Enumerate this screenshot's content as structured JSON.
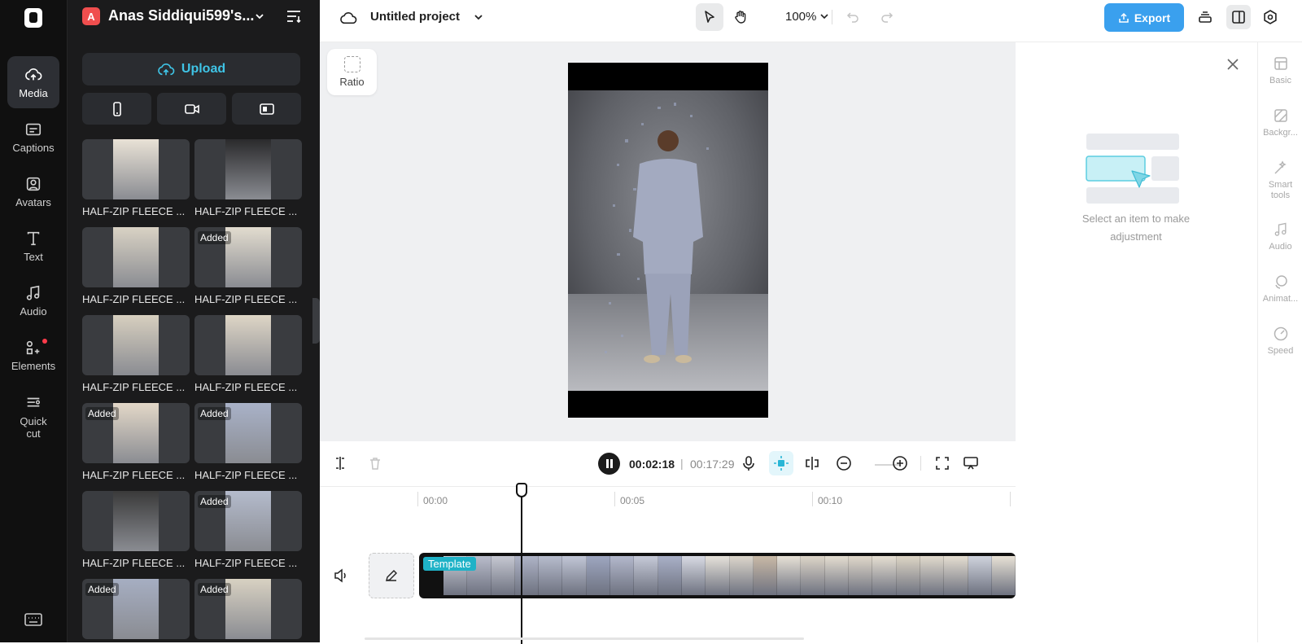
{
  "rail": {
    "items": [
      {
        "label": "Media",
        "icon": "cloud-upload-icon"
      },
      {
        "label": "Captions",
        "icon": "captions-icon"
      },
      {
        "label": "Avatars",
        "icon": "avatar-icon"
      },
      {
        "label": "Text",
        "icon": "text-icon"
      },
      {
        "label": "Audio",
        "icon": "music-note-icon"
      },
      {
        "label": "Elements",
        "icon": "elements-icon"
      },
      {
        "label": "Quick cut",
        "icon": "quick-cut-icon"
      }
    ]
  },
  "panel": {
    "workspace_initial": "A",
    "workspace_name": "Anas Siddiqui599's...",
    "upload_label": "Upload",
    "media": [
      {
        "label": "HALF-ZIP FLEECE ...",
        "added": "",
        "tone": "#e9e2d6"
      },
      {
        "label": "HALF-ZIP FLEECE ...",
        "added": "",
        "tone": "#2a2a2c"
      },
      {
        "label": "HALF-ZIP FLEECE ...",
        "added": "",
        "tone": "#d9d2c4"
      },
      {
        "label": "HALF-ZIP FLEECE ...",
        "added": "Added",
        "tone": "#e2dccf"
      },
      {
        "label": "HALF-ZIP FLEECE ...",
        "added": "",
        "tone": "#d7cfbf"
      },
      {
        "label": "HALF-ZIP FLEECE ...",
        "added": "",
        "tone": "#ded6c6"
      },
      {
        "label": "HALF-ZIP FLEECE ...",
        "added": "Added",
        "tone": "#e3d8c8"
      },
      {
        "label": "HALF-ZIP FLEECE ...",
        "added": "Added",
        "tone": "#a9b2c8"
      },
      {
        "label": "HALF-ZIP FLEECE ...",
        "added": "",
        "tone": "#3a3a3a"
      },
      {
        "label": "HALF-ZIP FLEECE ...",
        "added": "Added",
        "tone": "#b4bbcc"
      },
      {
        "label": "HALF-ZIP FLEECE ...",
        "added": "Added",
        "tone": "#a6aec2"
      },
      {
        "label": "HALF-ZIP FLEECE ...",
        "added": "Added",
        "tone": "#d8d1c2"
      }
    ]
  },
  "topbar": {
    "project_title": "Untitled project",
    "zoom": "100%",
    "export_label": "Export"
  },
  "canvas": {
    "ratio_label": "Ratio"
  },
  "transport": {
    "current_time": "00:02:18",
    "separator": "|",
    "total_time": "00:17:29"
  },
  "timeline": {
    "ticks": [
      "00:00",
      "00:05",
      "00:10"
    ],
    "template_label": "Template",
    "frame_tones": [
      "#c9ccd6",
      "#b9bccb",
      "#c6c8d2",
      "#aeb3c6",
      "#b7bccd",
      "#c1c6d6",
      "#9ea6c0",
      "#b3b8cc",
      "#c6cad8",
      "#a9b0c7",
      "#d8dae3",
      "#e6e2da",
      "#dcd6cb",
      "#c9b9a6",
      "#e7e1d6",
      "#ddd5c8",
      "#e4ddd0",
      "#e0d8ca",
      "#e6dfd2",
      "#ddd5c5",
      "#e1dacd",
      "#e5ded1",
      "#cfd3dd",
      "#e8e2d6"
    ],
    "playhead_fraction": 0.145
  },
  "right_panel": {
    "empty_text": "Select an item to make adjustment",
    "tabs": [
      {
        "label": "Basic",
        "icon": "basic-icon"
      },
      {
        "label": "Backgr...",
        "icon": "background-icon"
      },
      {
        "label": "Smart tools",
        "icon": "magic-wand-icon"
      },
      {
        "label": "Audio",
        "icon": "music-note-icon"
      },
      {
        "label": "Animat...",
        "icon": "animation-icon"
      },
      {
        "label": "Speed",
        "icon": "speed-icon"
      }
    ]
  }
}
